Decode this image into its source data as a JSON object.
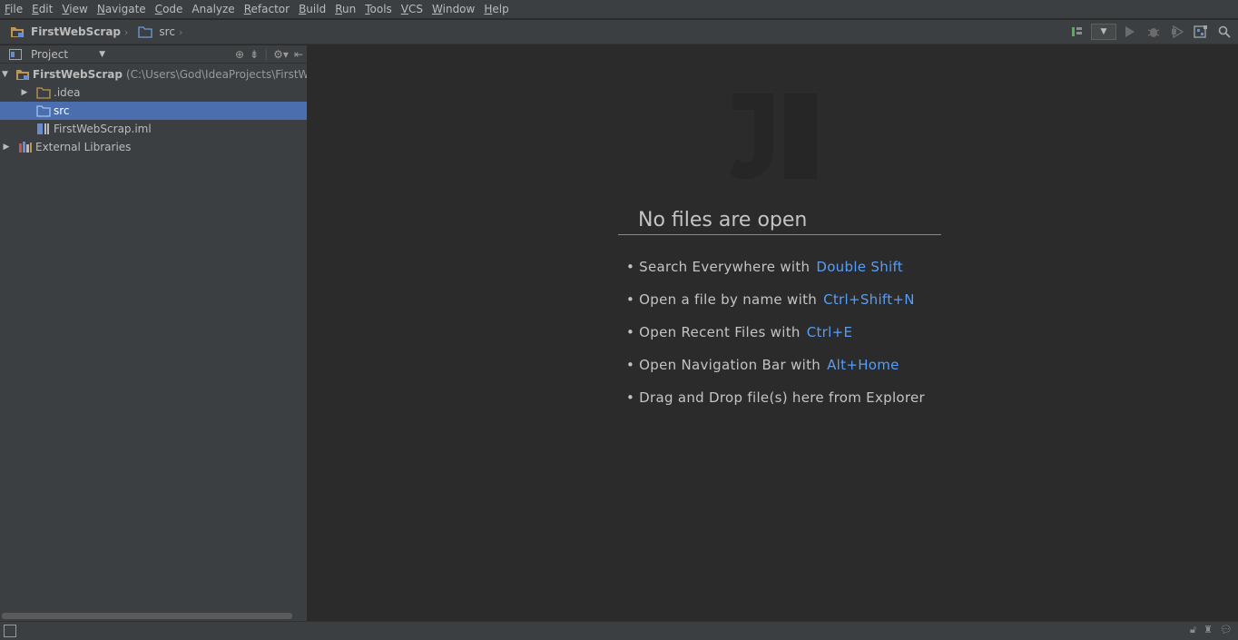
{
  "menu": [
    {
      "m": "F",
      "rest": "ile"
    },
    {
      "m": "E",
      "rest": "dit"
    },
    {
      "m": "V",
      "rest": "iew"
    },
    {
      "m": "N",
      "rest": "avigate"
    },
    {
      "m": "C",
      "rest": "ode"
    },
    {
      "m": "",
      "rest": "Analyze"
    },
    {
      "m": "R",
      "rest": "efactor"
    },
    {
      "m": "B",
      "rest": "uild"
    },
    {
      "m": "R",
      "rest": "un"
    },
    {
      "m": "T",
      "rest": "ools"
    },
    {
      "m": "V",
      "rest": "CS"
    },
    {
      "m": "W",
      "rest": "indow"
    },
    {
      "m": "H",
      "rest": "elp"
    }
  ],
  "breadcrumb": {
    "project": "FirstWebScrap",
    "folder": "src"
  },
  "project_panel": {
    "title": "Project",
    "tree": {
      "root_name": "FirstWebScrap",
      "root_path": "(C:\\Users\\God\\IdeaProjects\\FirstWebScrap)",
      "idea": ".idea",
      "src": "src",
      "iml": "FirstWebScrap.iml",
      "external": "External Libraries"
    }
  },
  "editor": {
    "empty_title": "No files are open",
    "hints": [
      {
        "text": "Search Everywhere with",
        "shortcut": "Double Shift"
      },
      {
        "text": "Open a file by name with",
        "shortcut": "Ctrl+Shift+N"
      },
      {
        "text": "Open Recent Files with",
        "shortcut": "Ctrl+E"
      },
      {
        "text": "Open Navigation Bar with",
        "shortcut": "Alt+Home"
      },
      {
        "text": "Drag and Drop file(s) here from Explorer",
        "shortcut": ""
      }
    ]
  },
  "colors": {
    "accent": "#589df6",
    "selection": "#4b6eaf",
    "panel": "#3c3f41",
    "editor": "#2b2b2b"
  }
}
